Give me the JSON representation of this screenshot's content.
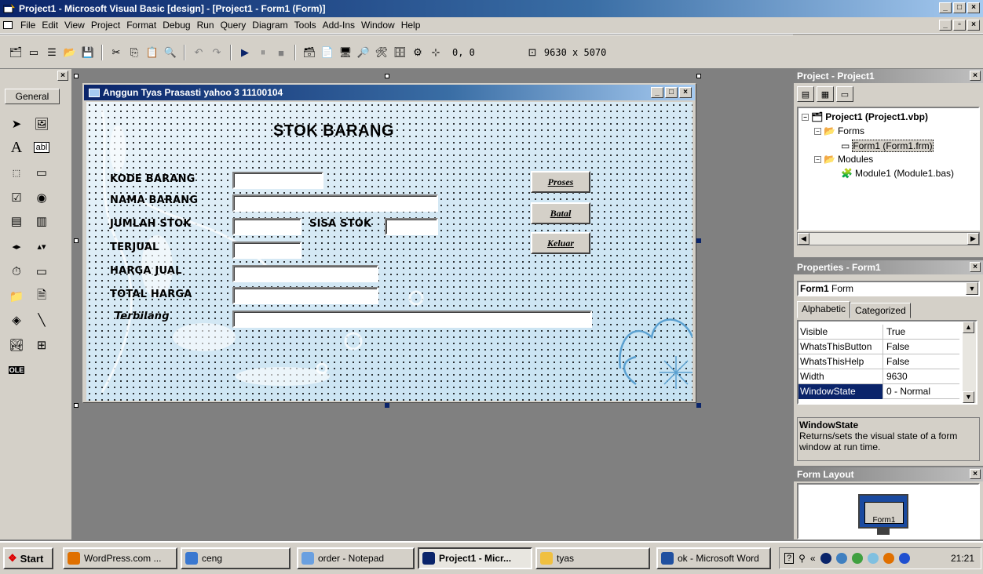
{
  "window": {
    "title": "Project1 - Microsoft Visual Basic [design] - [Project1 - Form1 (Form)]",
    "min": "_",
    "max": "□",
    "close": "×"
  },
  "menu": [
    "File",
    "Edit",
    "View",
    "Project",
    "Format",
    "Debug",
    "Run",
    "Query",
    "Diagram",
    "Tools",
    "Add-Ins",
    "Window",
    "Help"
  ],
  "toolbar": {
    "position": "0, 0",
    "size": "9630 x 5070"
  },
  "toolbox": {
    "tab": "General",
    "close": "×"
  },
  "form": {
    "title": "Anggun Tyas Prasasti yahoo 3 11100104",
    "heading": "STOK BARANG",
    "labels": {
      "kode": "KODE BARANG",
      "nama": "NAMA BARANG",
      "jumlah": "JUMLAH STOK",
      "sisa": "SISA STOK",
      "terjual": "TERJUAL",
      "harga": "HARGA JUAL",
      "total": "TOTAL HARGA",
      "terbilang": "Terbilang"
    },
    "buttons": {
      "proses": "Proses",
      "batal": "Batal",
      "keluar": "Keluar"
    }
  },
  "project_panel": {
    "title": "Project - Project1",
    "tree": {
      "root": "Project1 (Project1.vbp)",
      "forms": "Forms",
      "form1": "Form1 (Form1.frm)",
      "modules": "Modules",
      "module1": "Module1 (Module1.bas)"
    }
  },
  "properties_panel": {
    "title": "Properties - Form1",
    "object_name": "Form1",
    "object_type": "Form",
    "tabs": [
      "Alphabetic",
      "Categorized"
    ],
    "rows": [
      {
        "name": "Visible",
        "value": "True"
      },
      {
        "name": "WhatsThisButton",
        "value": "False"
      },
      {
        "name": "WhatsThisHelp",
        "value": "False"
      },
      {
        "name": "Width",
        "value": "9630"
      },
      {
        "name": "WindowState",
        "value": "0 - Normal"
      }
    ],
    "desc_title": "WindowState",
    "desc_text": "Returns/sets the visual state of a form window at run time."
  },
  "layout_panel": {
    "title": "Form Layout",
    "mini_label": "Form1"
  },
  "taskbar": {
    "start": "Start",
    "tasks": [
      "WordPress.com ...",
      "ceng",
      "order - Notepad",
      "Project1 - Micr...",
      "tyas",
      "ok - Microsoft Word"
    ],
    "clock": "21:21"
  },
  "colors": {
    "title_active": "#0a246a",
    "face": "#d4d0c8",
    "mdi_bg": "#808080"
  }
}
